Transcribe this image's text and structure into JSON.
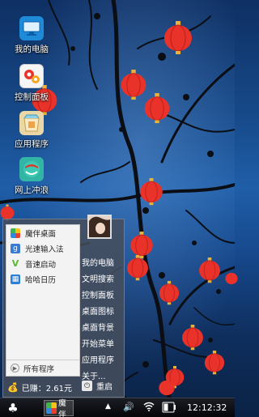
{
  "desktop": {
    "icons": [
      {
        "label": "我的电脑",
        "icon": "my-computer-icon",
        "color": "#1f8ad8"
      },
      {
        "label": "控制面板",
        "icon": "control-panel-icon",
        "color": "#f5a623"
      },
      {
        "label": "应用程序",
        "icon": "app-store-icon",
        "color": "#e9d7a5"
      },
      {
        "label": "网上冲浪",
        "icon": "browser-icon",
        "color": "#33b5a6"
      }
    ]
  },
  "start_menu": {
    "apps": [
      {
        "label": "魔伴桌面",
        "icon": "mobile-desktop-icon",
        "color": "#4a90e2"
      },
      {
        "label": "光速输入法",
        "icon": "input-method-icon",
        "color": "#3a7bd5"
      },
      {
        "label": "音速启动",
        "icon": "quick-launch-icon",
        "color": "#5cb82e"
      },
      {
        "label": "哈哈日历",
        "icon": "calendar-icon",
        "color": "#2b7fd6"
      }
    ],
    "all_programs": "所有程序",
    "right_items": [
      "我的电脑",
      "文明搜索",
      "控制面板",
      "桌面图标",
      "桌面背景",
      "开始菜单",
      "应用程序",
      "关于..."
    ],
    "used_space": "已赚：2.61元",
    "restart": "重启"
  },
  "taskbar": {
    "start_icon": "clover-icon",
    "app_label": "魔伴",
    "tray_up": "▲",
    "time": "12:12:32"
  },
  "colors": {
    "lantern": "#e8322a",
    "taskbar": "#0b0d12"
  }
}
